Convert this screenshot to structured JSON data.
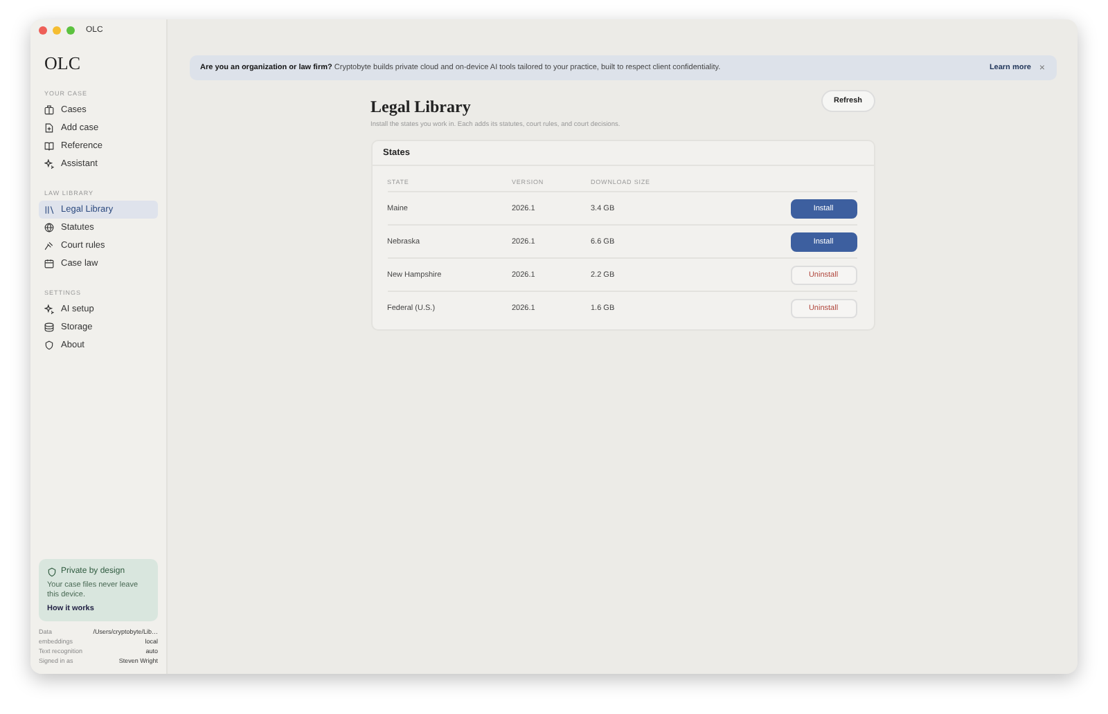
{
  "window": {
    "title": "OLC"
  },
  "sidebar": {
    "logo": "OLC",
    "sections": [
      {
        "heading": "YOUR CASE",
        "items": [
          {
            "label": "Cases",
            "selected": false
          },
          {
            "label": "Add case",
            "selected": false
          },
          {
            "label": "Reference",
            "selected": false
          },
          {
            "label": "Assistant",
            "selected": false
          }
        ]
      },
      {
        "heading": "LAW LIBRARY",
        "items": [
          {
            "label": "Legal Library",
            "selected": true
          },
          {
            "label": "Statutes",
            "selected": false
          },
          {
            "label": "Court rules",
            "selected": false
          },
          {
            "label": "Case law",
            "selected": false
          }
        ]
      },
      {
        "heading": "SETTINGS",
        "items": [
          {
            "label": "AI setup",
            "selected": false
          },
          {
            "label": "Storage",
            "selected": false
          },
          {
            "label": "About",
            "selected": false
          }
        ]
      }
    ],
    "privacy": {
      "title": "Private by design",
      "text": "Your case files never leave this device.",
      "link": "How it works"
    },
    "meta": [
      {
        "label": "Data",
        "value": "/Users/cryptobyte/Lib…"
      },
      {
        "label": "embeddings",
        "value": "local"
      },
      {
        "label": "Text recognition",
        "value": "auto"
      },
      {
        "label": "Signed in as",
        "value": "Steven Wright"
      }
    ]
  },
  "banner": {
    "lead": "Are you an organization or law firm?",
    "text": "Cryptobyte builds private cloud and on-device AI tools tailored to your practice, built to respect client confidentiality.",
    "link": "Learn more",
    "close": "×"
  },
  "page": {
    "title": "Legal Library",
    "subtitle": "Install the states you work in. Each adds its statutes, court rules, and court decisions.",
    "refresh": "Refresh"
  },
  "table": {
    "title": "States",
    "columns": [
      "STATE",
      "VERSION",
      "DOWNLOAD SIZE"
    ],
    "rows": [
      {
        "state": "Maine",
        "version": "2026.1",
        "size": "3.4 GB",
        "installed": false,
        "action": "Install"
      },
      {
        "state": "Nebraska",
        "version": "2026.1",
        "size": "6.6 GB",
        "installed": false,
        "action": "Install"
      },
      {
        "state": "New Hampshire",
        "version": "2026.1",
        "size": "2.2 GB",
        "installed": true,
        "action": "Uninstall"
      },
      {
        "state": "Federal (U.S.)",
        "version": "2026.1",
        "size": "1.6 GB",
        "installed": true,
        "action": "Uninstall"
      }
    ]
  }
}
